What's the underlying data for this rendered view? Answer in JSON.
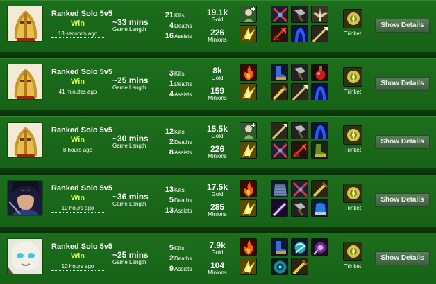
{
  "matches": [
    {
      "champion_icon": "golden-knight-portrait",
      "mode": "Ranked Solo 5v5",
      "result": "Win",
      "time_ago": "13 seconds ago",
      "length": "~33 mins",
      "length_label": "Game Length",
      "kills": "21",
      "kills_label": "Kills",
      "deaths": "4",
      "deaths_label": "Deaths",
      "assists": "16",
      "assists_label": "Assists",
      "gold": "19.1k",
      "gold_label": "Gold",
      "minions": "226",
      "minions_label": "Minions",
      "spells": [
        "heal-icon",
        "flash-icon"
      ],
      "items": [
        "crossed-blades-icon",
        "warhammer-icon",
        "winged-blade-icon",
        "red-axe-icon",
        "blue-hood-icon",
        "lance-icon"
      ],
      "trinket_icon": "trinket-totem-icon",
      "trinket_label": "Trinket",
      "details_label": "Show Details"
    },
    {
      "champion_icon": "golden-knight-portrait",
      "mode": "Ranked Solo 5v5",
      "result": "Win",
      "time_ago": "41 minutes ago",
      "length": "~25 mins",
      "length_label": "Game Length",
      "kills": "3",
      "kills_label": "Kills",
      "deaths": "1",
      "deaths_label": "Deaths",
      "assists": "4",
      "assists_label": "Assists",
      "gold": "8k",
      "gold_label": "Gold",
      "minions": "159",
      "minions_label": "Minions",
      "spells": [
        "ignite-icon",
        "flash-icon"
      ],
      "items": [
        "blue-boots-icon",
        "warhammer-icon",
        "red-potion-icon",
        "golden-sword-icon",
        "lance-icon",
        "blue-hood-icon"
      ],
      "trinket_icon": "trinket-totem-icon",
      "trinket_label": "Trinket",
      "details_label": "Show Details"
    },
    {
      "champion_icon": "golden-knight-portrait",
      "mode": "Ranked Solo 5v5",
      "result": "Win",
      "time_ago": "8 hours ago",
      "length": "~30 mins",
      "length_label": "Game Length",
      "kills": "12",
      "kills_label": "Kills",
      "deaths": "2",
      "deaths_label": "Deaths",
      "assists": "8",
      "assists_label": "Assists",
      "gold": "15.5k",
      "gold_label": "Gold",
      "minions": "226",
      "minions_label": "Minions",
      "spells": [
        "heal-icon",
        "flash-icon"
      ],
      "items": [
        "lance-icon",
        "warhammer-icon",
        "blue-hood-icon",
        "crossed-blades-icon",
        "red-axe-icon",
        "green-greaves-icon"
      ],
      "trinket_icon": "trinket-totem-icon",
      "trinket_label": "Trinket",
      "details_label": "Show Details"
    },
    {
      "champion_icon": "dark-swordsman-portrait",
      "mode": "Ranked Solo 5v5",
      "result": "Win",
      "time_ago": "10 hours ago",
      "length": "~36 mins",
      "length_label": "Game Length",
      "kills": "13",
      "kills_label": "Kills",
      "deaths": "5",
      "deaths_label": "Deaths",
      "assists": "13",
      "assists_label": "Assists",
      "gold": "17.5k",
      "gold_label": "Gold",
      "minions": "285",
      "minions_label": "Minions",
      "spells": [
        "ignite-icon",
        "flash-icon"
      ],
      "items": [
        "chain-vest-icon",
        "crossed-blades-icon",
        "golden-sword-icon",
        "purple-blade-icon",
        "warhammer-icon",
        "blue-gauntlet-icon"
      ],
      "trinket_icon": "trinket-totem-icon",
      "trinket_label": "Trinket",
      "details_label": "Show Details"
    },
    {
      "champion_icon": "masked-spirit-portrait",
      "mode": "Ranked Solo 5v5",
      "result": "Win",
      "time_ago": "10 hours ago",
      "length": "~25 mins",
      "length_label": "Game Length",
      "kills": "5",
      "kills_label": "Kills",
      "deaths": "2",
      "deaths_label": "Deaths",
      "assists": "9",
      "assists_label": "Assists",
      "gold": "7.9k",
      "gold_label": "Gold",
      "minions": "104",
      "minions_label": "Minions",
      "spells": [
        "ignite-icon",
        "flash-icon"
      ],
      "items": [
        "blue-boots-icon",
        "wind-orb-icon",
        "void-staff-icon",
        "teal-orb-icon",
        "golden-sword-icon",
        "empty-slot"
      ],
      "trinket_icon": "trinket-totem-icon",
      "trinket_label": "Trinket",
      "details_label": "Show Details"
    }
  ]
}
